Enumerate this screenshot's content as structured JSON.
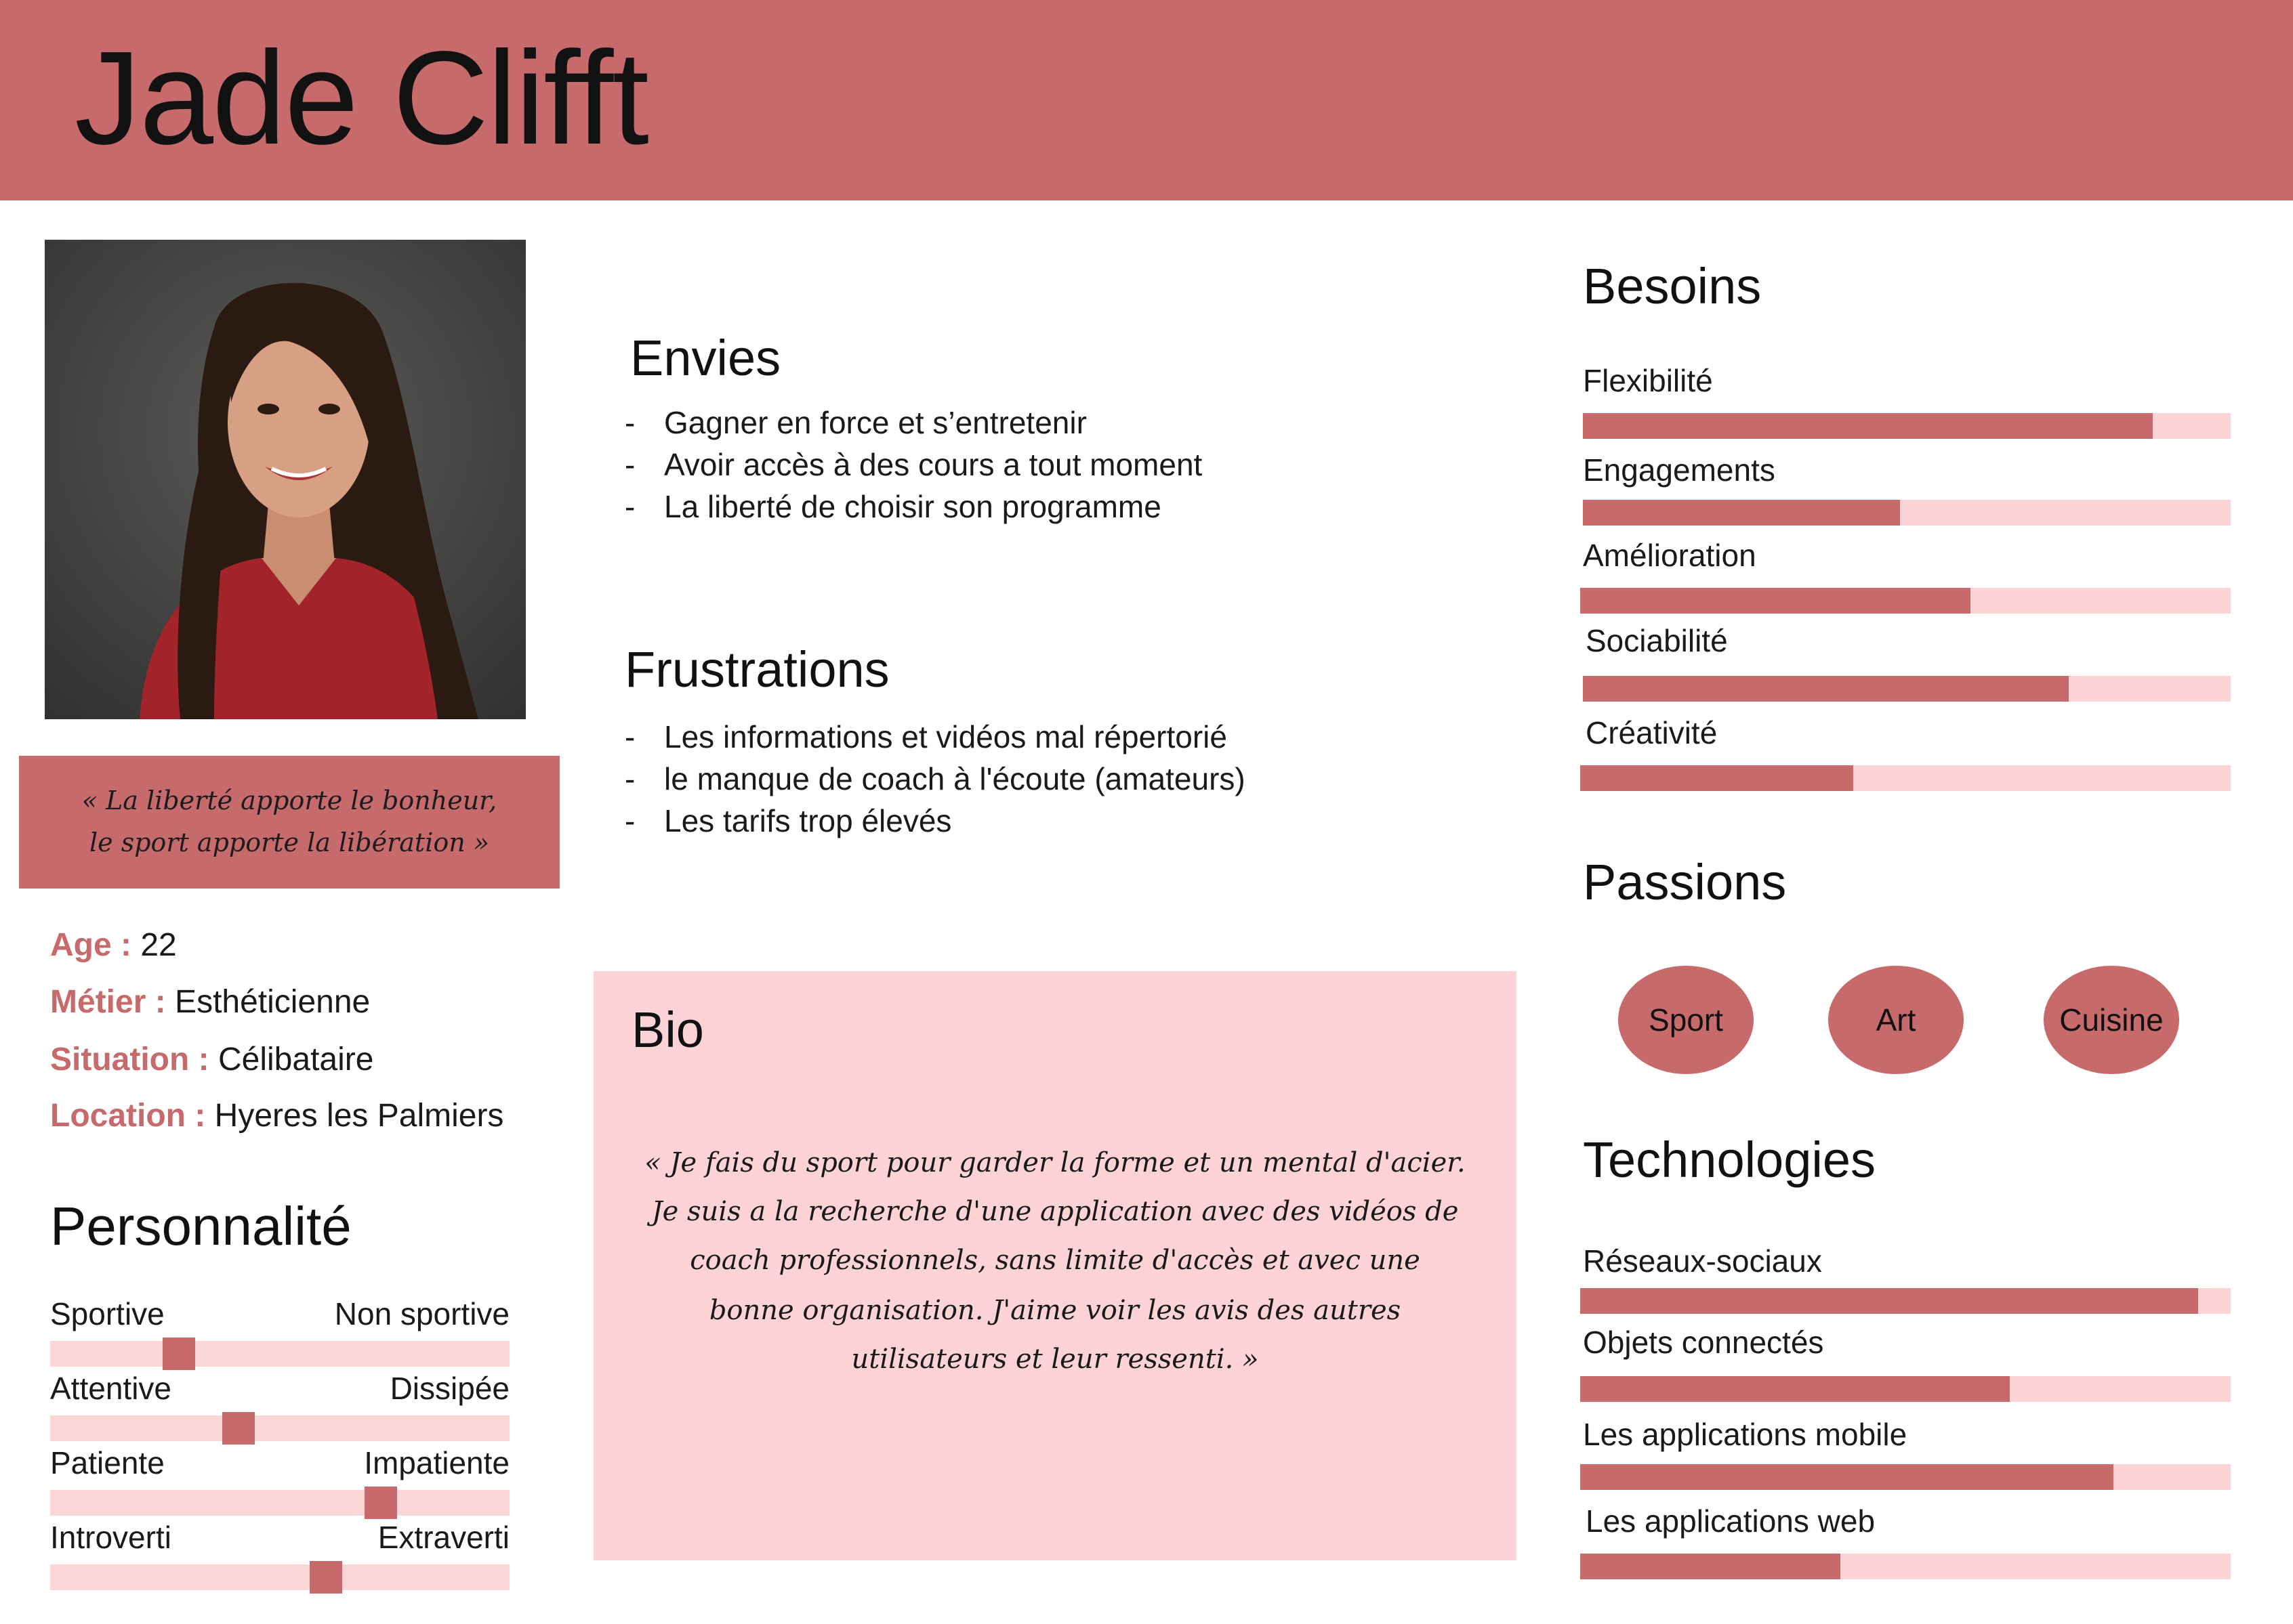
{
  "name": "Jade Clifft",
  "quote": [
    "« La liberté apporte le bonheur,",
    "le sport apporte la libération »"
  ],
  "info": [
    {
      "label": "Age :",
      "value": "22"
    },
    {
      "label": "Métier :",
      "value": "Esthéticienne"
    },
    {
      "label": "Situation :",
      "value": "Célibataire"
    },
    {
      "label": "Location :",
      "value": "Hyeres les Palmiers"
    }
  ],
  "personality": {
    "title": "Personnalité",
    "traits": [
      {
        "left": "Sportive",
        "right": "Non sportive",
        "level": 0.28
      },
      {
        "left": "Attentive",
        "right": "Dissipée",
        "level": 0.41
      },
      {
        "left": "Patiente",
        "right": "Impatiente",
        "level": 0.72
      },
      {
        "left": "Introverti",
        "right": "Extraverti",
        "level": 0.6
      }
    ]
  },
  "envies": {
    "title": "Envies",
    "dash": "-",
    "items": [
      "Gagner en force et s’entretenir",
      "Avoir accès à des cours a tout moment",
      "La liberté de choisir son programme"
    ]
  },
  "frustrations": {
    "title": "Frustrations",
    "dash": "-",
    "items": [
      "Les informations et vidéos mal répertorié",
      "le manque de coach à l'écoute (amateurs)",
      "Les tarifs trop élevés"
    ]
  },
  "bio": {
    "title": "Bio",
    "lines": [
      "« Je fais du sport pour garder la forme et un mental d'acier.",
      "Je suis a la recherche d'une application avec des vidéos de",
      "coach professionnels, sans limite d'accès et avec une",
      "bonne organisation. J'aime voir les avis des autres",
      "utilisateurs et leur ressenti. »"
    ]
  },
  "besoins": {
    "title": "Besoins",
    "items": [
      {
        "label": "Flexibilité",
        "level": 0.88
      },
      {
        "label": "Engagements",
        "level": 0.49
      },
      {
        "label": "Amélioration",
        "level": 0.6
      },
      {
        "label": "Sociabilité",
        "level": 0.75
      },
      {
        "label": "Créativité",
        "level": 0.42
      }
    ]
  },
  "passions": {
    "title": "Passions",
    "items": [
      "Sport",
      "Art",
      "Cuisine"
    ]
  },
  "technologies": {
    "title": "Technologies",
    "items": [
      {
        "label": "Réseaux-sociaux",
        "level": 0.95
      },
      {
        "label": "Objets connectés",
        "level": 0.66
      },
      {
        "label": "Les applications mobile",
        "level": 0.82
      },
      {
        "label": "Les applications web",
        "level": 0.4
      }
    ]
  },
  "colors": {
    "accent": "#c76a6c",
    "light": "#fdd3d6"
  }
}
